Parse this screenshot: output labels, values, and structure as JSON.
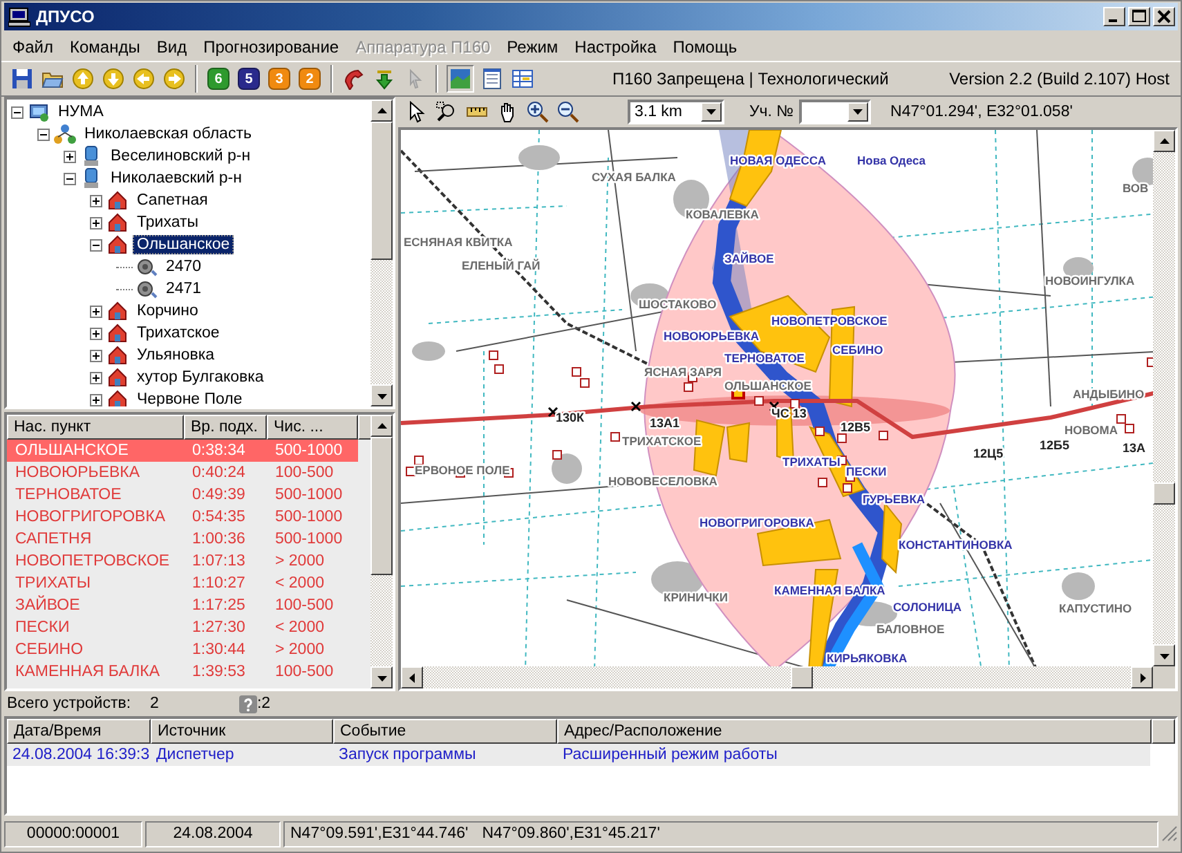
{
  "window": {
    "title": "ДПУСО"
  },
  "menu": [
    {
      "label": "Файл",
      "disabled": false
    },
    {
      "label": "Команды",
      "disabled": false
    },
    {
      "label": "Вид",
      "disabled": false
    },
    {
      "label": "Прогнозирование",
      "disabled": false
    },
    {
      "label": "Аппаратура П160",
      "disabled": true
    },
    {
      "label": "Режим",
      "disabled": false
    },
    {
      "label": "Настройка",
      "disabled": false
    },
    {
      "label": "Помощь",
      "disabled": false
    }
  ],
  "toolbar": {
    "number_buttons": [
      {
        "label": "6",
        "color": "#2e9a2e"
      },
      {
        "label": "5",
        "color": "#2a2a8c"
      },
      {
        "label": "3",
        "color": "#f08a10"
      },
      {
        "label": "2",
        "color": "#f08a10"
      }
    ],
    "status": "П160 Запрещена | Технологический",
    "version": "Version 2.2 (Build 2.107) Host"
  },
  "tree": [
    {
      "label": "НУМА",
      "kind": "root",
      "expanded": true,
      "selected": false,
      "children": [
        {
          "label": "Николаевская область",
          "kind": "region",
          "expanded": true,
          "selected": false,
          "children": [
            {
              "label": "Веселиновский р-н",
              "kind": "district",
              "expanded": false,
              "selected": false
            },
            {
              "label": "Николаевский р-н",
              "kind": "district",
              "expanded": true,
              "selected": false,
              "children": [
                {
                  "label": "Сапетная",
                  "kind": "settlement",
                  "expanded": false,
                  "selected": false
                },
                {
                  "label": "Трихаты",
                  "kind": "settlement",
                  "expanded": false,
                  "selected": false
                },
                {
                  "label": "Ольшанское",
                  "kind": "settlement",
                  "expanded": true,
                  "selected": true,
                  "children": [
                    {
                      "label": "2470",
                      "kind": "device",
                      "selected": false
                    },
                    {
                      "label": "2471",
                      "kind": "device",
                      "selected": false
                    }
                  ]
                },
                {
                  "label": "Корчино",
                  "kind": "settlement",
                  "expanded": false,
                  "selected": false
                },
                {
                  "label": "Трихатское",
                  "kind": "settlement",
                  "expanded": false,
                  "selected": false
                },
                {
                  "label": "Ульяновка",
                  "kind": "settlement",
                  "expanded": false,
                  "selected": false
                },
                {
                  "label": "хутор Булгаковка",
                  "kind": "settlement",
                  "expanded": false,
                  "selected": false
                },
                {
                  "label": "Червоне Поле",
                  "kind": "settlement",
                  "expanded": false,
                  "selected": false
                }
              ]
            }
          ]
        }
      ]
    }
  ],
  "settlements_table": {
    "columns": [
      "Нас. пункт",
      "Вр. подх.",
      "Чис. ..."
    ],
    "rows": [
      {
        "cells": [
          "ОЛЬШАНСКОЕ",
          "0:38:34",
          "500-1000"
        ],
        "selected": true
      },
      {
        "cells": [
          "НОВОЮРЬЕВКА",
          "0:40:24",
          "100-500"
        ],
        "selected": false
      },
      {
        "cells": [
          "ТЕРНОВАТОЕ",
          "0:49:39",
          "500-1000"
        ],
        "selected": false
      },
      {
        "cells": [
          "НОВОГРИГОРОВКА",
          "0:54:35",
          "500-1000"
        ],
        "selected": false
      },
      {
        "cells": [
          "САПЕТНЯ",
          "1:00:36",
          "500-1000"
        ],
        "selected": false
      },
      {
        "cells": [
          "НОВОПЕТРОВСКОЕ",
          "1:07:13",
          "> 2000"
        ],
        "selected": false
      },
      {
        "cells": [
          "ТРИХАТЫ",
          "1:10:27",
          "< 2000"
        ],
        "selected": false
      },
      {
        "cells": [
          "ЗАЙВОЕ",
          "1:17:25",
          "100-500"
        ],
        "selected": false
      },
      {
        "cells": [
          "ПЕСКИ",
          "1:27:30",
          "< 2000"
        ],
        "selected": false
      },
      {
        "cells": [
          "СЕБИНО",
          "1:30:44",
          "> 2000"
        ],
        "selected": false
      },
      {
        "cells": [
          "КАМЕННАЯ БАЛКА",
          "1:39:53",
          "100-500"
        ],
        "selected": false
      }
    ]
  },
  "devices_bar": {
    "label": "Всего устройств:",
    "count": "2",
    "unknown_count": ":2"
  },
  "map": {
    "scale": "3.1 km",
    "plot_label": "Уч. №",
    "coordinates": "N47°01.294', E32°01.058'",
    "labels": [
      {
        "text": "НОВАЯ ОДЕССА",
        "kind": "settlement"
      },
      {
        "text": "Нова Одеса",
        "kind": "settlement"
      },
      {
        "text": "СУХАЯ БАЛКА",
        "kind": "village"
      },
      {
        "text": "ВОВ",
        "kind": "village"
      },
      {
        "text": "КОВАЛЕВКА",
        "kind": "village"
      },
      {
        "text": "ЕСНЯНАЯ КВИТКА",
        "kind": "village"
      },
      {
        "text": "ЗАЙВОЕ",
        "kind": "settlement"
      },
      {
        "text": "ЕЛЕНЫЙ ГАЙ",
        "kind": "village"
      },
      {
        "text": "НОВОИНГУЛКА",
        "kind": "village"
      },
      {
        "text": "ШОСТАКОВО",
        "kind": "village"
      },
      {
        "text": "НОВОПЕТРОВСКОЕ",
        "kind": "settlement"
      },
      {
        "text": "НОВОЮРЬЕВКА",
        "kind": "settlement"
      },
      {
        "text": "СЕБИНО",
        "kind": "settlement"
      },
      {
        "text": "ТЕРНОВАТОЕ",
        "kind": "settlement"
      },
      {
        "text": "ЯСНАЯ ЗАРЯ",
        "kind": "village"
      },
      {
        "text": "ОЛЬШАНСКОЕ",
        "kind": "village"
      },
      {
        "text": "АНДЫБИНО",
        "kind": "village"
      },
      {
        "text": "130К",
        "kind": "marker"
      },
      {
        "text": "13А1",
        "kind": "marker"
      },
      {
        "text": "ЧС 13",
        "kind": "marker"
      },
      {
        "text": "12В5",
        "kind": "marker"
      },
      {
        "text": "НОВОМА",
        "kind": "village"
      },
      {
        "text": "ТРИХАТСКОЕ",
        "kind": "village"
      },
      {
        "text": "12Б5",
        "kind": "marker"
      },
      {
        "text": "13А",
        "kind": "marker"
      },
      {
        "text": "12Ц5",
        "kind": "marker"
      },
      {
        "text": "ТРИХАТЫ",
        "kind": "settlement"
      },
      {
        "text": "ЕРВОНОЕ ПОЛЕ",
        "kind": "village"
      },
      {
        "text": "ПЕСКИ",
        "kind": "settlement"
      },
      {
        "text": "НОВОВЕСЕЛОВКА",
        "kind": "village"
      },
      {
        "text": "ГУРЬЕВКА",
        "kind": "settlement"
      },
      {
        "text": "НОВОГРИГОРОВКА",
        "kind": "settlement"
      },
      {
        "text": "КОНСТАНТИНОВКА",
        "kind": "settlement"
      },
      {
        "text": "КАМЕННАЯ БАЛКА",
        "kind": "settlement"
      },
      {
        "text": "КРИНИЧКИ",
        "kind": "village"
      },
      {
        "text": "СОЛОНИЦА",
        "kind": "settlement"
      },
      {
        "text": "КАПУСТИНО",
        "kind": "village"
      },
      {
        "text": "БАЛОВНОЕ",
        "kind": "village"
      },
      {
        "text": "КИРЬЯКОВКА",
        "kind": "settlement"
      }
    ]
  },
  "log": {
    "columns": [
      "Дата/Время",
      "Источник",
      "Событие",
      "Адрес/Расположение"
    ],
    "rows": [
      {
        "cells": [
          "24.08.2004 16:39:3",
          "Диспетчер",
          "Запуск программы",
          "Расширенный режим работы"
        ],
        "selected": true
      }
    ]
  },
  "status_bar": [
    "00000:00001",
    "24.08.2004",
    "N47°09.591',E31°44.746'",
    "N47°09.860',E31°45.217'"
  ]
}
